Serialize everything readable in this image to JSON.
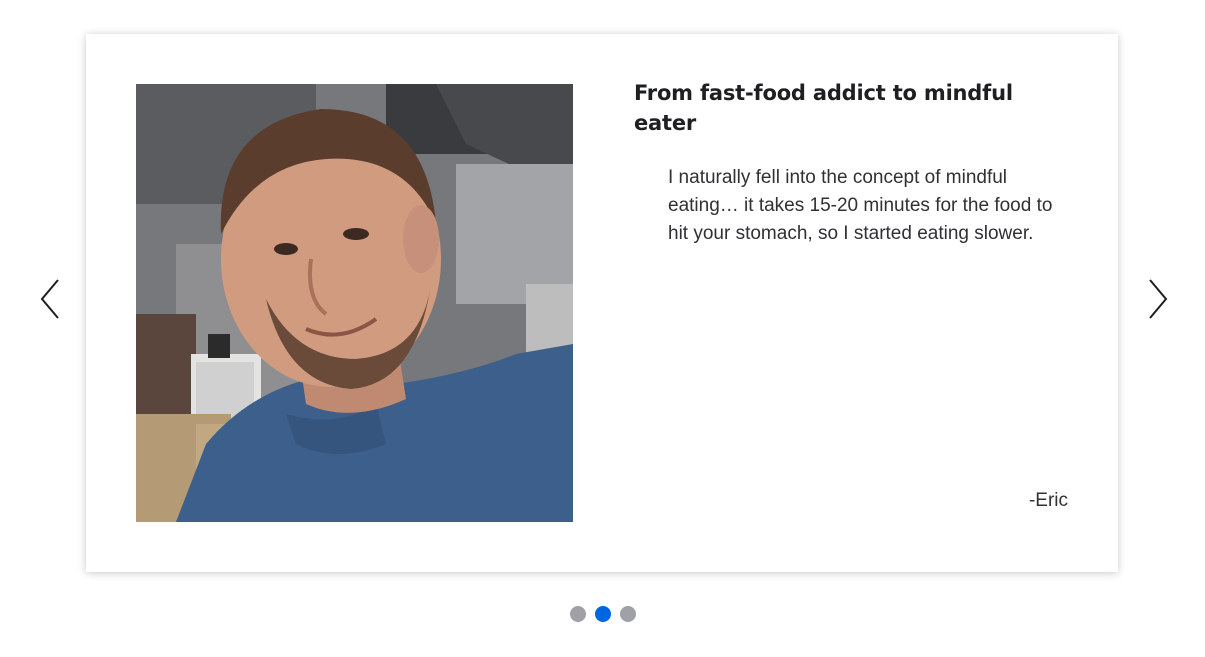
{
  "carousel": {
    "prev_icon": "chevron-left-icon",
    "next_icon": "chevron-right-icon",
    "active_index": 1,
    "dot_count": 3,
    "colors": {
      "dot_active": "#0066e0",
      "dot_inactive": "#9fa1a6"
    }
  },
  "slide": {
    "title": "From fast-food addict to mindful eater",
    "quote": "I naturally fell into the concept of mindful eating… it takes 15-20 minutes for the food to hit your stomach, so I started eating slower.",
    "author": "-Eric"
  }
}
